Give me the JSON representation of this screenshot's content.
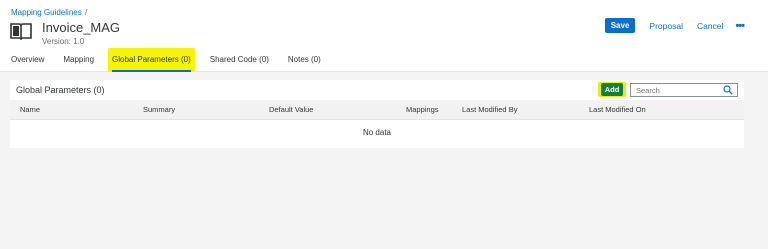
{
  "breadcrumb": {
    "link": "Mapping Guidelines",
    "separator": "/"
  },
  "object": {
    "title": "Invoice_MAG",
    "version": "Version: 1.0",
    "icon": "book-icon"
  },
  "actions": {
    "save": "Save",
    "proposal": "Proposal",
    "cancel": "Cancel",
    "more": "•••"
  },
  "tabs": [
    {
      "label": "Overview"
    },
    {
      "label": "Mapping"
    },
    {
      "label": "Global Parameters (0)",
      "active": true
    },
    {
      "label": "Shared Code (0)"
    },
    {
      "label": "Notes (0)"
    }
  ],
  "panel": {
    "title": "Global Parameters (0)",
    "add": "Add",
    "search_placeholder": "Search",
    "columns": [
      "Name",
      "Summary",
      "Default Value",
      "Mappings",
      "Last Modified By",
      "Last Modified On"
    ],
    "empty": "No data"
  },
  "colors": {
    "accent": "#0a6ed1",
    "add_button": "#107e3e",
    "highlight": "#f5f500"
  }
}
